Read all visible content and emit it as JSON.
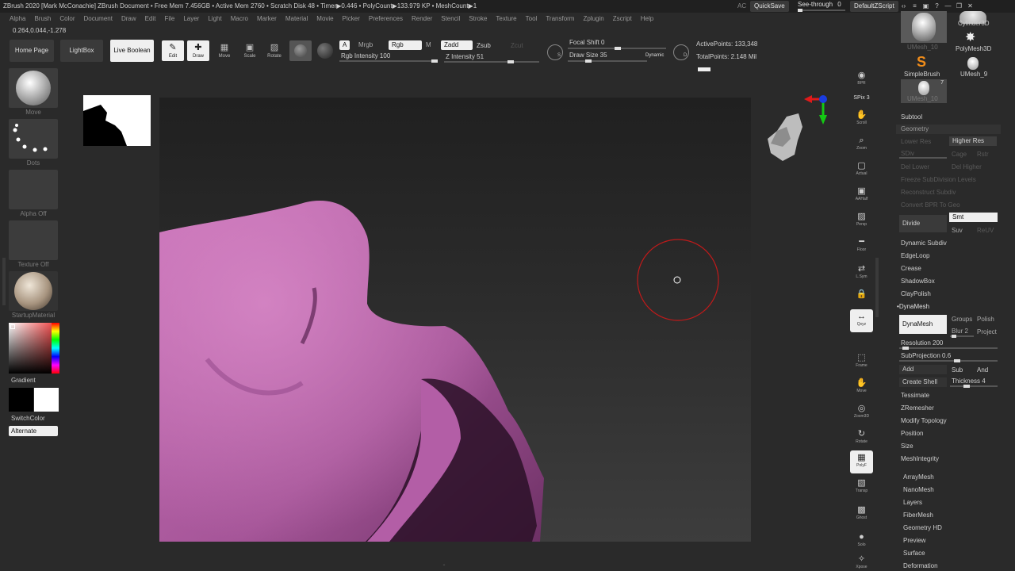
{
  "titlebar": {
    "text": "ZBrush 2020 [Mark McConachie]  ZBrush Document   • Free Mem 7.456GB • Active Mem 2760 • Scratch Disk 48 • Timer▶0.446 • PolyCount▶133.979 KP • MeshCount▶1",
    "ac": "AC",
    "quicksave": "QuickSave",
    "see_through": "See-through",
    "see_through_value": "0",
    "default_zscript": "DefaultZScript"
  },
  "menu": [
    "Alpha",
    "Brush",
    "Color",
    "Document",
    "Draw",
    "Edit",
    "File",
    "Layer",
    "Light",
    "Macro",
    "Marker",
    "Material",
    "Movie",
    "Picker",
    "Preferences",
    "Render",
    "Stencil",
    "Stroke",
    "Texture",
    "Tool",
    "Transform",
    "Zplugin",
    "Zscript",
    "Help"
  ],
  "coords": "0.264,0.044,-1.278",
  "shelf": {
    "home_page": "Home Page",
    "lightbox": "LightBox",
    "live_boolean": "Live Boolean",
    "edit": "Edit",
    "draw": "Draw",
    "move": "Move",
    "scale": "Scale",
    "rotate": "Rotate",
    "a": "A",
    "mrgb": "Mrgb",
    "rgb": "Rgb",
    "m": "M",
    "zadd": "Zadd",
    "zsub": "Zsub",
    "zcut": "Zcut",
    "rgb_intensity": "Rgb Intensity 100",
    "z_intensity": "Z Intensity 51",
    "focal_shift": "Focal Shift 0",
    "draw_size": "Draw Size 35",
    "dynamic": "Dynamic",
    "s_label": "S",
    "d_label": "D",
    "active_points": "ActivePoints: 133,348",
    "total_points": "TotalPoints: 2.148 Mil"
  },
  "left_tray": {
    "brush": "Move",
    "stroke": "Dots",
    "alpha": "Alpha Off",
    "texture": "Texture Off",
    "material": "StartupMaterial",
    "gradient": "Gradient",
    "switch_color": "SwitchColor",
    "alternate": "Alternate"
  },
  "right_icons": [
    {
      "name": "bpr-icon",
      "label": "BPR"
    },
    {
      "name": "spix-icon",
      "label": "SPix 3"
    },
    {
      "name": "scroll-icon",
      "label": "Scroll"
    },
    {
      "name": "zoom-icon",
      "label": "Zoom"
    },
    {
      "name": "actual-icon",
      "label": "Actual"
    },
    {
      "name": "aahalf-icon",
      "label": "AAHalf"
    },
    {
      "name": "persp-icon",
      "label": "Persp"
    },
    {
      "name": "floor-icon",
      "label": "Floor"
    },
    {
      "name": "lsym-icon",
      "label": "L.Sym"
    },
    {
      "name": "lock-icon",
      "label": ""
    },
    {
      "name": "xyz-icon",
      "label": "Qxyz"
    },
    {
      "name": "frame-icon",
      "label": "Frame"
    },
    {
      "name": "move-icon",
      "label": "Move"
    },
    {
      "name": "zoom3d-icon",
      "label": "Zoom3D"
    },
    {
      "name": "rotate-icon",
      "label": "Rotate"
    },
    {
      "name": "polyf-icon",
      "label": "PolyF"
    },
    {
      "name": "transp-icon",
      "label": "Transp"
    },
    {
      "name": "ghost-icon",
      "label": "Ghost"
    },
    {
      "name": "solo-icon",
      "label": "Solo"
    },
    {
      "name": "xpose-icon",
      "label": "Xpose"
    }
  ],
  "right_panel": {
    "tools": [
      "UMesh_10",
      "Cylinder3D",
      "PolyMesh3D",
      "SimpleBrush",
      "UMesh_9",
      "UMesh_10"
    ],
    "tool_count": "7",
    "subtool": "Subtool",
    "geometry": "Geometry",
    "lower_res": "Lower Res",
    "higher_res": "Higher Res",
    "sdiv": "SDiv",
    "cage": "Cage",
    "rstr": "Rstr",
    "del_lower": "Del Lower",
    "del_higher": "Del Higher",
    "freeze": "Freeze SubDivision Levels",
    "reconstruct": "Reconstruct Subdiv",
    "convert": "Convert BPR To Geo",
    "divide": "Divide",
    "smt": "Smt",
    "suv": "Suv",
    "reuv": "ReUV",
    "items_a": [
      "Dynamic Subdiv",
      "EdgeLoop",
      "Crease",
      "ShadowBox",
      "ClayPolish"
    ],
    "dynamesh_header": "DynaMesh",
    "dynamesh_btn": "DynaMesh",
    "groups": "Groups",
    "polish": "Polish",
    "blur": "Blur 2",
    "project": "Project",
    "resolution": "Resolution 200",
    "subprojection": "SubProjection 0.6",
    "add": "Add",
    "sub": "Sub",
    "and": "And",
    "create_shell": "Create Shell",
    "thickness": "Thickness 4",
    "items_b": [
      "Tessimate",
      "ZRemesher",
      "Modify Topology",
      "Position",
      "Size",
      "MeshIntegrity"
    ],
    "items_c": [
      "ArrayMesh",
      "NanoMesh",
      "Layers",
      "FiberMesh",
      "Geometry HD",
      "Preview",
      "Surface",
      "Deformation"
    ]
  },
  "colors": {
    "mesh": "#c468b0",
    "brush_cursor": "#c01a1a",
    "bg": "#2a2a2a"
  }
}
